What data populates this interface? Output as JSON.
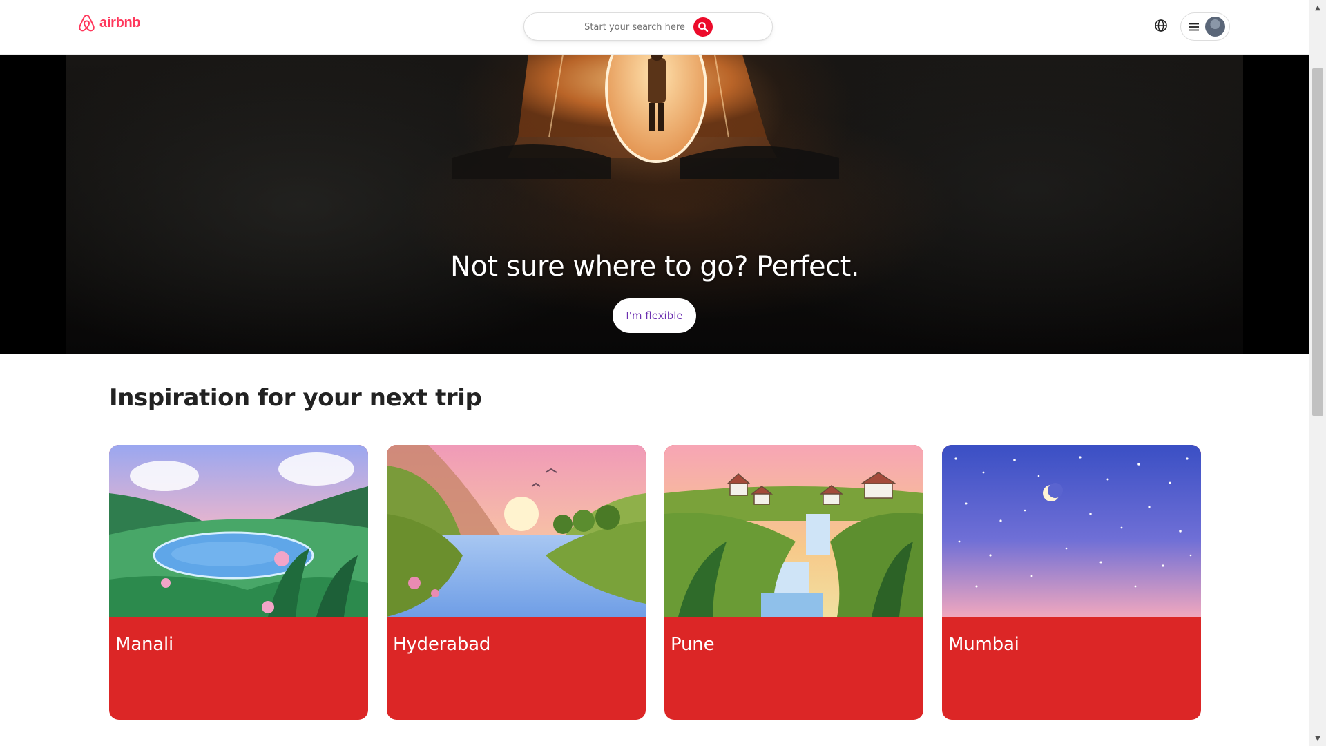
{
  "header": {
    "logo_text": "airbnb",
    "search": {
      "placeholder": "Start your search here"
    },
    "icons": {
      "search": "search-icon",
      "globe": "globe-icon",
      "menu": "hamburger-menu-icon",
      "avatar": "user-avatar"
    }
  },
  "hero": {
    "heading": "Not sure where to go? Perfect.",
    "button_label": "I'm flexible"
  },
  "inspiration": {
    "title": "Inspiration for your next trip",
    "cards": [
      {
        "label": "Manali"
      },
      {
        "label": "Hyderabad"
      },
      {
        "label": "Pune"
      },
      {
        "label": "Mumbai"
      }
    ]
  },
  "colors": {
    "brand": "#ff385c",
    "search_button": "#ec0b2b",
    "card_background": "#dc2626",
    "flexible_button_text": "#6b2fb0"
  }
}
